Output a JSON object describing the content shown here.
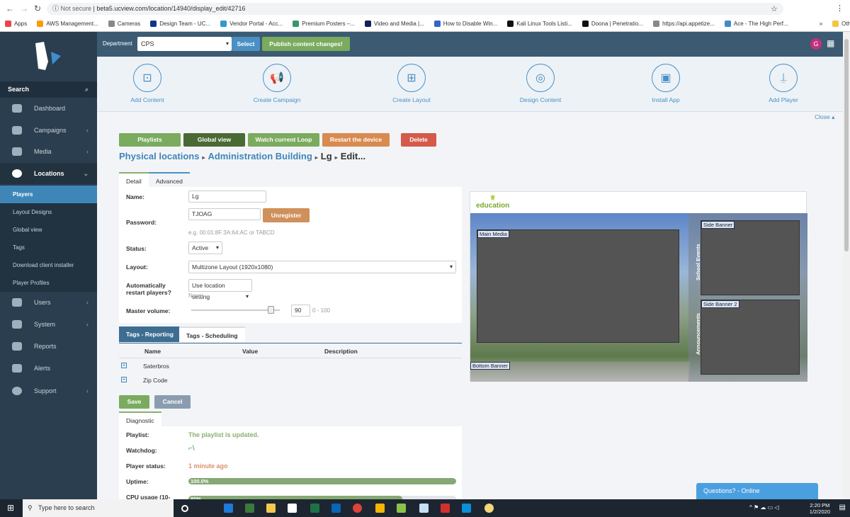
{
  "browser": {
    "not_secure": "Not secure",
    "url": "beta5.ucview.com/location/14940/display_edit/42716",
    "bookmarks": [
      "Apps",
      "AWS Management...",
      "Cameras",
      "Design Team - UC...",
      "Vendor Portal - Acc...",
      "Premium Posters –...",
      "Video and Media |...",
      "How to Disable Win...",
      "Kali Linux Tools Listi...",
      "Doona | Penetratio...",
      "https://api.appetize...",
      "Ace - The High Perf..."
    ],
    "other_bookmarks": "Other bookmarks",
    "overflow": "»"
  },
  "sidebar": {
    "search": "Search",
    "items": [
      {
        "label": "Dashboard"
      },
      {
        "label": "Campaigns"
      },
      {
        "label": "Media"
      },
      {
        "label": "Locations"
      }
    ],
    "sub": [
      "Players",
      "Layout Designs",
      "Global view",
      "Tags",
      "Download client installer",
      "Player Profiles"
    ],
    "items2": [
      {
        "label": "Users"
      },
      {
        "label": "System"
      },
      {
        "label": "Reports"
      },
      {
        "label": "Alerts"
      },
      {
        "label": "Support"
      }
    ]
  },
  "header": {
    "department_label": "Department",
    "department": "CPS",
    "select": "Select",
    "publish": "Publish content changes!",
    "avatar": "G"
  },
  "actions": [
    "Add Content",
    "Create Campaign",
    "Create Layout",
    "Design Content",
    "Install App",
    "Add Player"
  ],
  "close": "Close ▴",
  "buttons": {
    "playlists": "Playlists",
    "global_view": "Global view",
    "watch": "Watch current Loop",
    "restart": "Restart the device",
    "delete": "Delete"
  },
  "breadcrumb": {
    "a": "Physical locations",
    "b": "Administration Building",
    "c": "Lg",
    "d": "Edit..."
  },
  "tabs": {
    "detail": "Detail",
    "advanced": "Advanced"
  },
  "form": {
    "name_label": "Name:",
    "name": "Lg",
    "password_label": "Password:",
    "password": "TJOAG",
    "unregister": "Unregister",
    "password_hint": "e.g. 00:01:8F:3A:64:AC or TABCD",
    "status_label": "Status:",
    "status": "Active",
    "layout_label": "Layout:",
    "layout": "Multizone Layout (1920x1080)",
    "restart_label": "Automatically restart players?",
    "restart": "Use location setting",
    "restart_hint": "Never",
    "volume_label": "Master volume:",
    "volume": "90",
    "volume_range": "0 - 100",
    "volume_fraction": 0.9
  },
  "tag_tabs": {
    "reporting": "Tags - Reporting",
    "scheduling": "Tags - Scheduling"
  },
  "tags": {
    "headers": [
      "Name",
      "Value",
      "Description"
    ],
    "rows": [
      {
        "name": "Saterbros"
      },
      {
        "name": "Zip Code"
      }
    ]
  },
  "form_buttons": {
    "save": "Save",
    "cancel": "Cancel"
  },
  "diagnostic": {
    "tab": "Diagnostic",
    "playlist_label": "Playlist:",
    "playlist": "The playlist is updated.",
    "watchdog_label": "Watchdog:",
    "player_status_label": "Player status:",
    "player_status": "1 minute ago",
    "uptime_label": "Uptime:",
    "uptime": "100.0%",
    "uptime_value": 100,
    "cpu_label": "CPU usage (10-",
    "cpu": "80%",
    "cpu_value": 80
  },
  "preview": {
    "logo": "education",
    "zones": [
      "Main Media",
      "Side Banner",
      "Side Banner 2",
      "Bottom Banner"
    ],
    "vertical": [
      "School Events",
      "Announcements"
    ]
  },
  "chat": "Questions? - Online",
  "taskbar": {
    "search": "Type here to search",
    "time": "2:20 PM",
    "date": "1/2/2020"
  }
}
